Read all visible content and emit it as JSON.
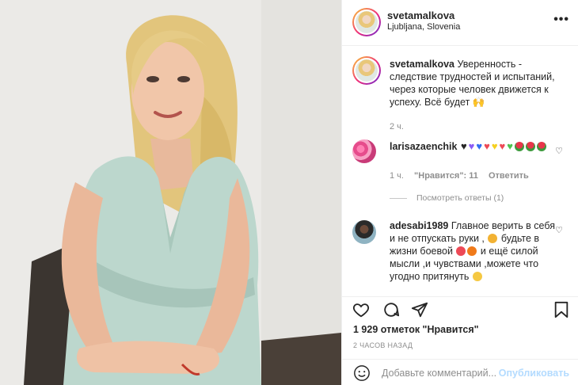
{
  "post": {
    "username": "svetamalkova",
    "location": "Ljubljana, Slovenia",
    "more_icon": "more-dots-icon"
  },
  "caption": {
    "username": "svetamalkova",
    "text": "Уверенность - следствие трудностей и испытаний, через которые человек движется к успеху. Всё будет",
    "emoji": "🙌",
    "time": "2 ч."
  },
  "comments": [
    {
      "username": "larisazaenchik",
      "text": "",
      "hearts": [
        "#262626",
        "#8a5cf5",
        "#2f6ef0",
        "#ed4956",
        "#f5d020",
        "#ed4956",
        "#4fc24f"
      ],
      "roses": 3,
      "time": "1 ч.",
      "likes": "\"Нравится\": 11",
      "reply": "Ответить",
      "view_replies": "Посмотреть ответы (1)"
    },
    {
      "username": "adesabi1989",
      "text_1": "Главное верить в себя и не отпускать руки ,",
      "text_2": "будьте в жизни боевой",
      "text_3": "и ещё силой мысли ,и чувствами ,можете что угодно притянуть"
    }
  ],
  "actions": {
    "like_icon": "heart-icon",
    "comment_icon": "comment-icon",
    "share_icon": "share-icon",
    "save_icon": "bookmark-icon"
  },
  "likes_text": "1 929 отметок \"Нравится\"",
  "time_ago": "2 ЧАСОВ НАЗАД",
  "add_comment": {
    "placeholder": "Добавьте комментарий...",
    "post_label": "Опубликовать",
    "emoji_icon": "smiley-icon"
  },
  "colors": {
    "accent": "#0095f6",
    "muted": "#8e8e8e",
    "border": "#efefef"
  }
}
